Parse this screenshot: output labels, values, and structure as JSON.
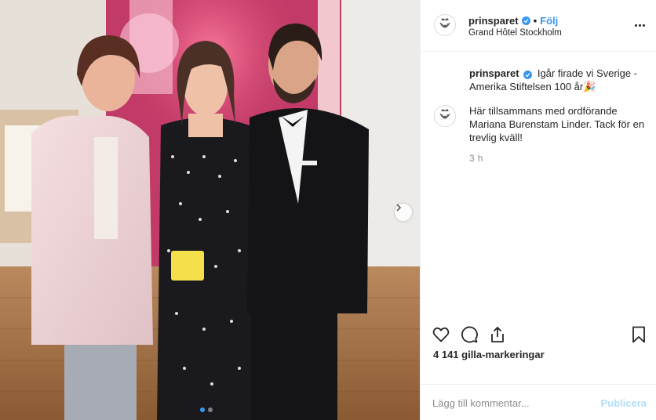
{
  "photo": {
    "alt_subject": "three-people-group-photo",
    "carousel_dots": 2,
    "active_dot": 0
  },
  "header": {
    "username": "prinsparet",
    "separator": "•",
    "follow_label": "Följ",
    "location": "Grand Hôtel Stockholm"
  },
  "comments": {
    "caption_user": "prinsparet",
    "caption_text": "Igår firade vi Sverige - Amerika Stiftelsen 100 år🎉",
    "second_text": "Här tillsammans med ordförande Mariana Burenstam Linder. Tack för en trevlig kväll!",
    "time": "3 h"
  },
  "actions": {
    "like_icon": "heart-icon",
    "comment_icon": "comment-icon",
    "share_icon": "share-icon",
    "save_icon": "bookmark-icon"
  },
  "likes": "4 141 gilla-markeringar",
  "add_comment": {
    "placeholder": "Lägg till kommentar...",
    "publish_label": "Publicera"
  },
  "colors": {
    "accent": "#3897f0",
    "publish_disabled": "#b2dffc",
    "muted": "#8e8e8e",
    "border": "#efefef"
  }
}
